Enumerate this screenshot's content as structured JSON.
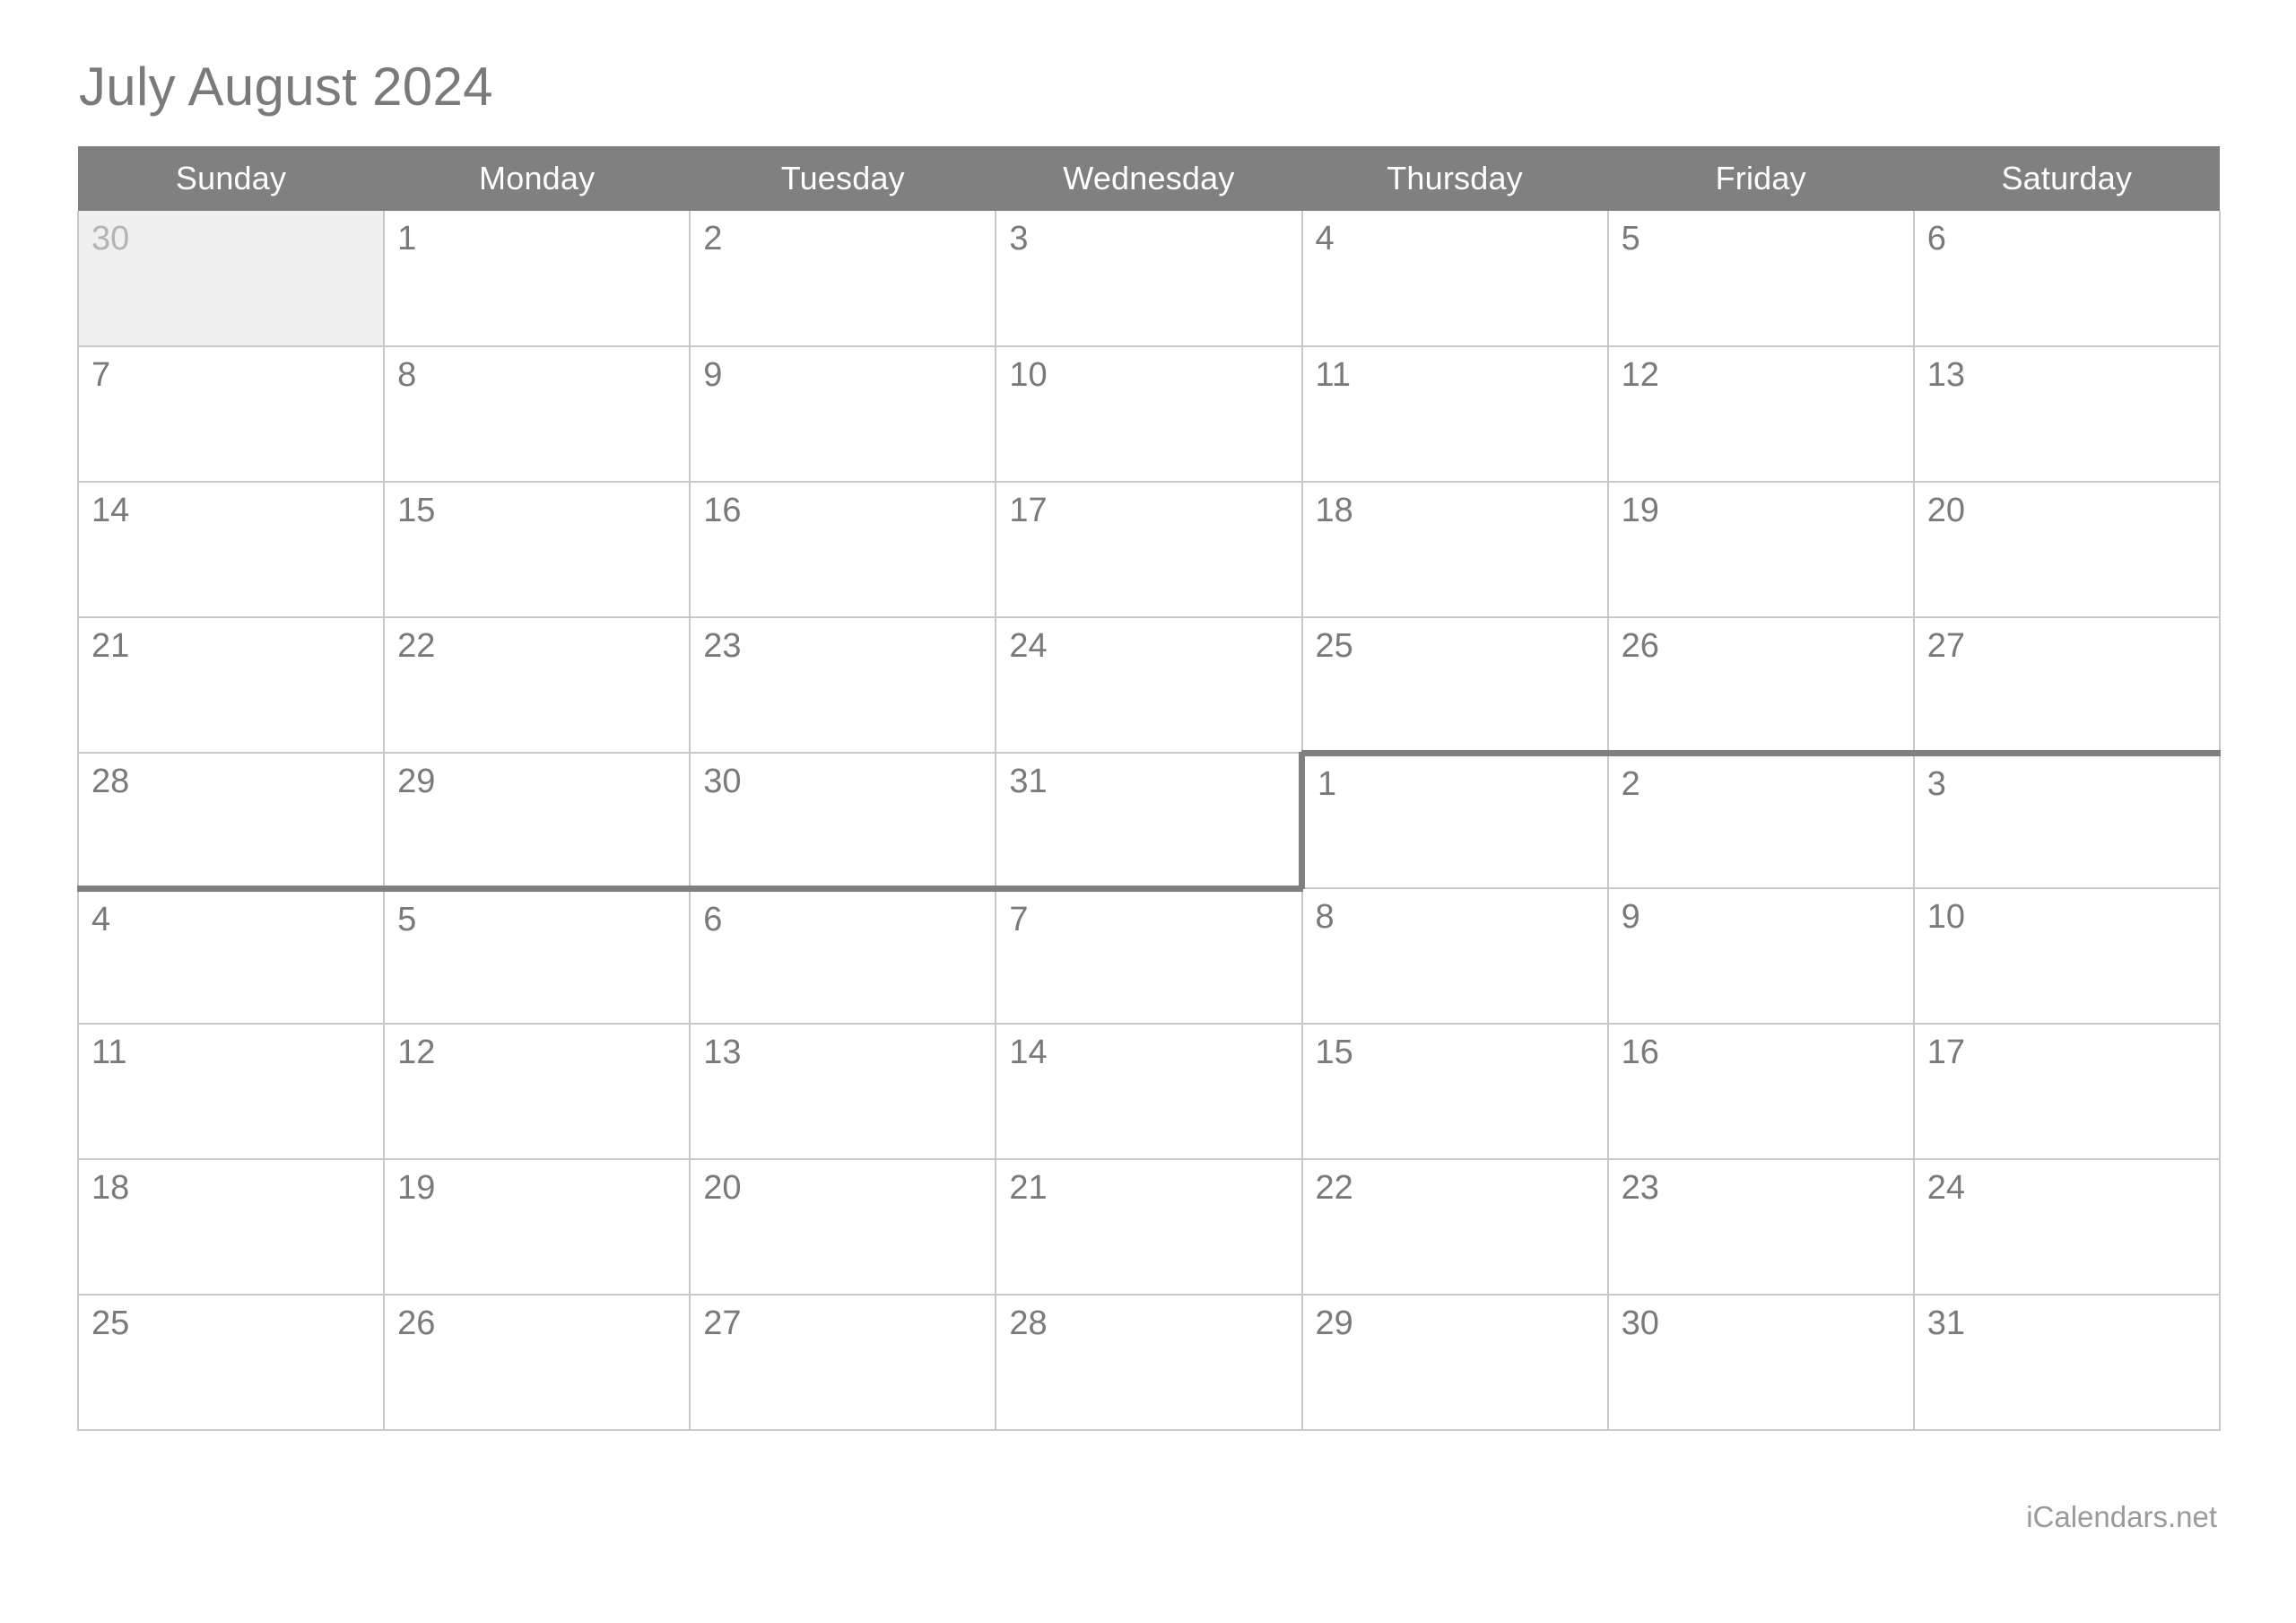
{
  "title": "July August 2024",
  "weekdays": [
    "Sunday",
    "Monday",
    "Tuesday",
    "Wednesday",
    "Thursday",
    "Friday",
    "Saturday"
  ],
  "footer": {
    "brand": "iCalendars.net"
  },
  "colors": {
    "header_bg": "#808080",
    "header_text": "#ffffff",
    "title_text": "#7a7a7a",
    "date_text": "#7a7a7a",
    "other_month_bg": "#f0f0f0",
    "other_month_text": "#b4b4b4",
    "grid_line": "#c8c8c8",
    "month_boundary": "#808080",
    "cell_bg": "#ffffff",
    "footer_text": "#9a9a9a"
  },
  "weeks": [
    [
      {
        "day": "30",
        "other_month": true
      },
      {
        "day": "1"
      },
      {
        "day": "2"
      },
      {
        "day": "3"
      },
      {
        "day": "4"
      },
      {
        "day": "5"
      },
      {
        "day": "6"
      }
    ],
    [
      {
        "day": "7"
      },
      {
        "day": "8"
      },
      {
        "day": "9"
      },
      {
        "day": "10"
      },
      {
        "day": "11"
      },
      {
        "day": "12"
      },
      {
        "day": "13"
      }
    ],
    [
      {
        "day": "14"
      },
      {
        "day": "15"
      },
      {
        "day": "16"
      },
      {
        "day": "17"
      },
      {
        "day": "18"
      },
      {
        "day": "19"
      },
      {
        "day": "20"
      }
    ],
    [
      {
        "day": "21"
      },
      {
        "day": "22"
      },
      {
        "day": "23"
      },
      {
        "day": "24"
      },
      {
        "day": "25"
      },
      {
        "day": "26"
      },
      {
        "day": "27"
      }
    ],
    [
      {
        "day": "28",
        "boundary_bottom": true
      },
      {
        "day": "29",
        "boundary_bottom": true
      },
      {
        "day": "30",
        "boundary_bottom": true
      },
      {
        "day": "31",
        "boundary_bottom": true
      },
      {
        "day": "1",
        "boundary_top": true,
        "boundary_left": true
      },
      {
        "day": "2",
        "boundary_top": true
      },
      {
        "day": "3",
        "boundary_top": true
      }
    ],
    [
      {
        "day": "4"
      },
      {
        "day": "5"
      },
      {
        "day": "6"
      },
      {
        "day": "7"
      },
      {
        "day": "8"
      },
      {
        "day": "9"
      },
      {
        "day": "10"
      }
    ],
    [
      {
        "day": "11"
      },
      {
        "day": "12"
      },
      {
        "day": "13"
      },
      {
        "day": "14"
      },
      {
        "day": "15"
      },
      {
        "day": "16"
      },
      {
        "day": "17"
      }
    ],
    [
      {
        "day": "18"
      },
      {
        "day": "19"
      },
      {
        "day": "20"
      },
      {
        "day": "21"
      },
      {
        "day": "22"
      },
      {
        "day": "23"
      },
      {
        "day": "24"
      }
    ],
    [
      {
        "day": "25"
      },
      {
        "day": "26"
      },
      {
        "day": "27"
      },
      {
        "day": "28"
      },
      {
        "day": "29"
      },
      {
        "day": "30"
      },
      {
        "day": "31"
      }
    ]
  ]
}
